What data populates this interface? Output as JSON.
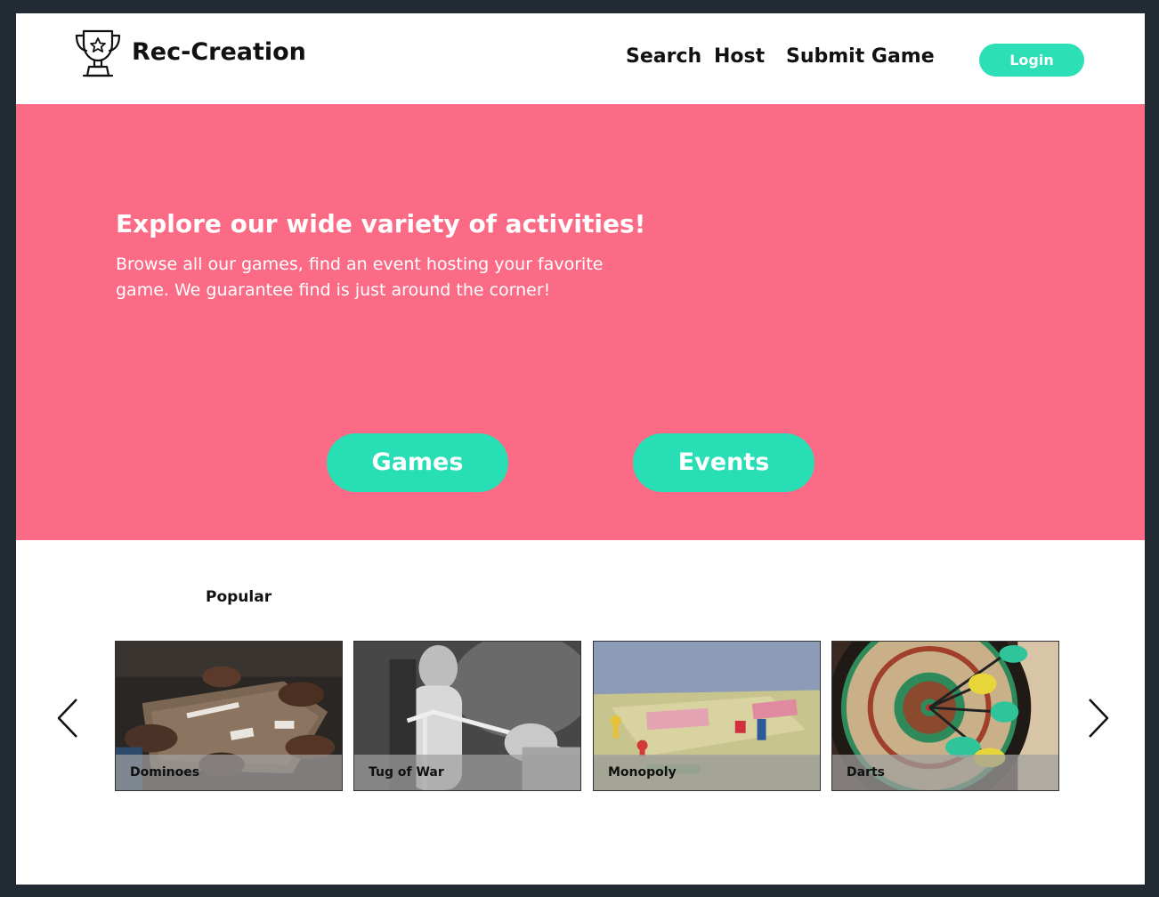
{
  "header": {
    "brand": "Rec-Creation",
    "logo_icon": "trophy-icon",
    "nav": {
      "search": "Search",
      "host": "Host",
      "submit_game": "Submit Game"
    },
    "login_label": "Login"
  },
  "hero": {
    "title": "Explore our wide variety of activities!",
    "subtitle": "Browse all our games, find an event hosting your favorite game. We guarantee find is just around the corner!",
    "buttons": {
      "games": "Games",
      "events": "Events"
    },
    "background_color": "#fb6b86",
    "accent_color": "#28deb4"
  },
  "popular": {
    "title": "Popular",
    "prev_icon": "chevron-left-icon",
    "next_icon": "chevron-right-icon",
    "cards": [
      {
        "label": "Dominoes"
      },
      {
        "label": "Tug of War"
      },
      {
        "label": "Monopoly"
      },
      {
        "label": "Darts"
      }
    ]
  }
}
